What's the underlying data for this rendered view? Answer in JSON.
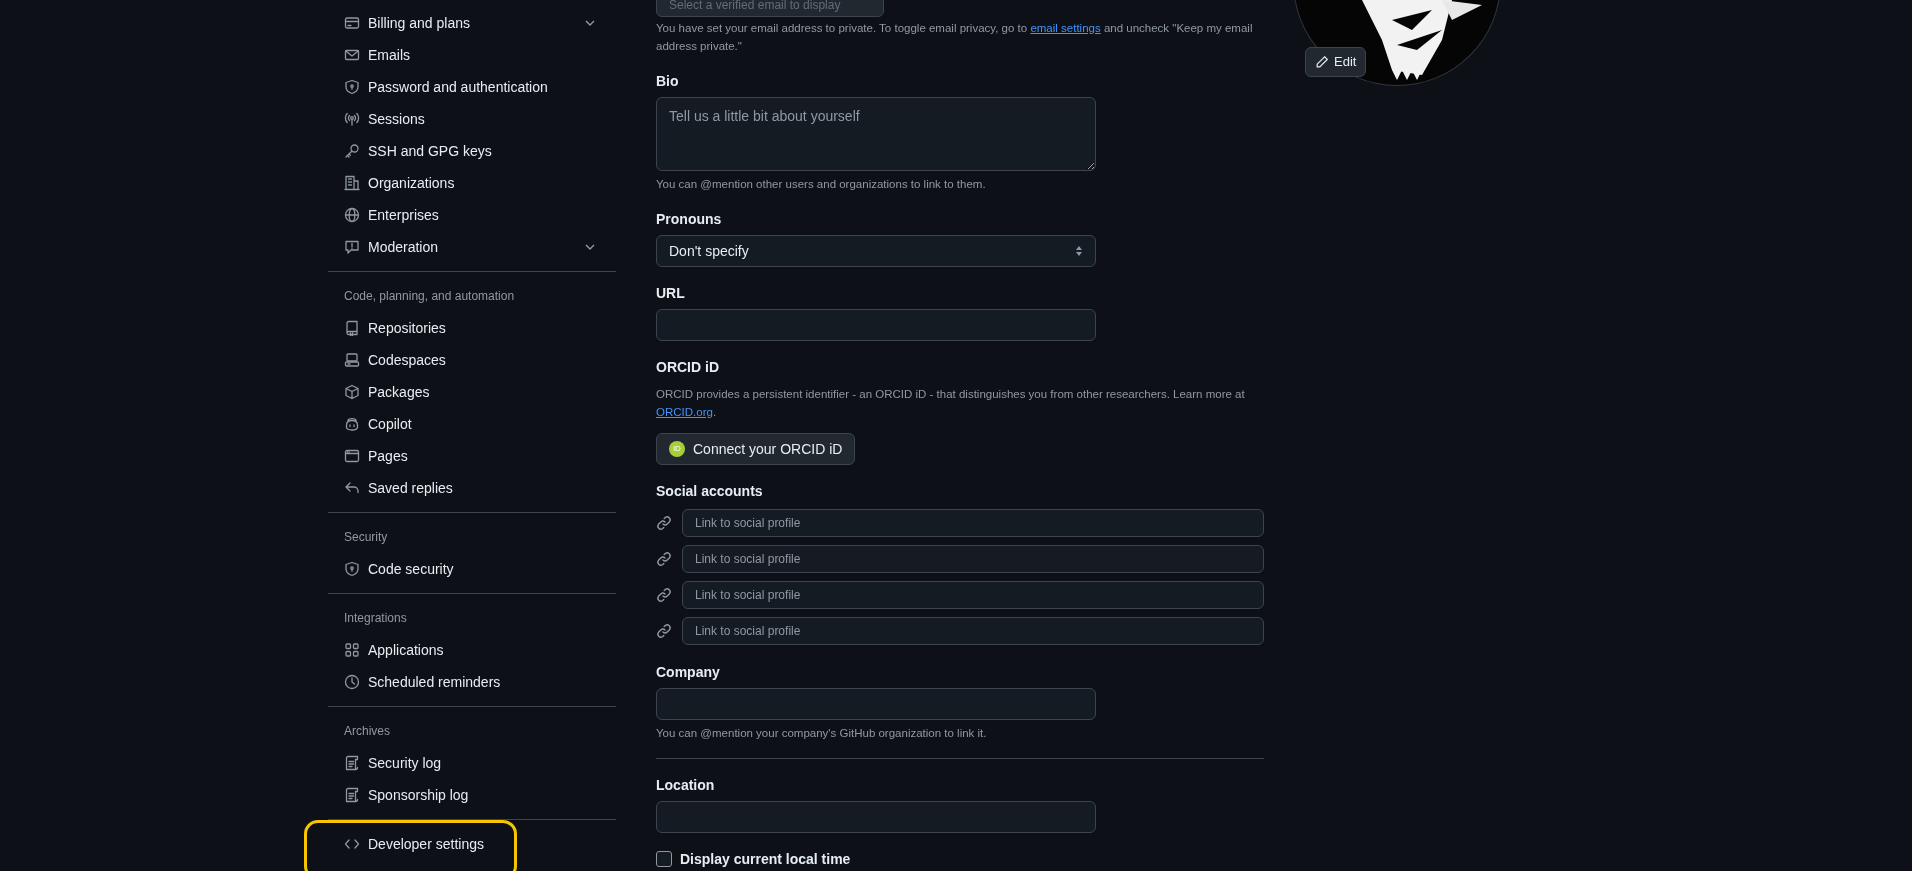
{
  "sidebar": {
    "sections": [
      {
        "items": [
          {
            "label": "Billing and plans",
            "kind": "group",
            "expanded": false,
            "highlighted": false
          },
          {
            "label": "Emails",
            "kind": "link",
            "highlighted": false
          },
          {
            "label": "Password and authentication",
            "kind": "link",
            "highlighted": false
          },
          {
            "label": "Sessions",
            "kind": "link",
            "highlighted": false
          },
          {
            "label": "SSH and GPG keys",
            "kind": "link",
            "highlighted": false
          },
          {
            "label": "Organizations",
            "kind": "link",
            "highlighted": false
          },
          {
            "label": "Enterprises",
            "kind": "link",
            "highlighted": false
          },
          {
            "label": "Moderation",
            "kind": "group",
            "expanded": false,
            "highlighted": false
          }
        ]
      },
      {
        "heading": "Code, planning, and automation",
        "items": [
          {
            "label": "Repositories",
            "kind": "link",
            "highlighted": false
          },
          {
            "label": "Codespaces",
            "kind": "link",
            "highlighted": false
          },
          {
            "label": "Packages",
            "kind": "link",
            "highlighted": false
          },
          {
            "label": "Copilot",
            "kind": "link",
            "highlighted": false
          },
          {
            "label": "Pages",
            "kind": "link",
            "highlighted": false
          },
          {
            "label": "Saved replies",
            "kind": "link",
            "highlighted": false
          }
        ]
      },
      {
        "heading": "Security",
        "items": [
          {
            "label": "Code security",
            "kind": "link",
            "highlighted": false
          }
        ]
      },
      {
        "heading": "Integrations",
        "items": [
          {
            "label": "Applications",
            "kind": "link",
            "highlighted": false
          },
          {
            "label": "Scheduled reminders",
            "kind": "link",
            "highlighted": false
          }
        ]
      },
      {
        "heading": "Archives",
        "items": [
          {
            "label": "Security log",
            "kind": "link",
            "highlighted": false
          },
          {
            "label": "Sponsorship log",
            "kind": "link",
            "highlighted": false
          }
        ]
      },
      {
        "items": [
          {
            "label": "Developer settings",
            "kind": "link",
            "highlighted": true
          }
        ]
      }
    ]
  },
  "email": {
    "value": "Select a verified email to display",
    "disabled": true,
    "note_before": "You have set your email address to private. To toggle email privacy, go to ",
    "note_link": "email settings",
    "note_after": " and uncheck \"Keep my email address private.\""
  },
  "bio": {
    "label": "Bio",
    "placeholder": "Tell us a little bit about yourself",
    "note": "You can @mention other users and organizations to link to them."
  },
  "pronouns": {
    "label": "Pronouns",
    "value": "Don't specify"
  },
  "url": {
    "label": "URL"
  },
  "orcid": {
    "label": "ORCID iD",
    "text_before": "ORCID provides a persistent identifier - an ORCID iD - that distinguishes you from other researchers. Learn more at ",
    "link": "ORCID.org",
    "text_after": ".",
    "button": "Connect your ORCID iD",
    "badge": "iD"
  },
  "social": {
    "label": "Social accounts",
    "fields": [
      {
        "placeholder": "Link to social profile"
      },
      {
        "placeholder": "Link to social profile"
      },
      {
        "placeholder": "Link to social profile"
      },
      {
        "placeholder": "Link to social profile"
      }
    ]
  },
  "company": {
    "label": "Company",
    "note": "You can @mention your company's GitHub organization to link it."
  },
  "location": {
    "label": "Location"
  },
  "local_time": {
    "label": "Display current local time",
    "checked": false
  },
  "avatar": {
    "edit_button": "Edit"
  }
}
